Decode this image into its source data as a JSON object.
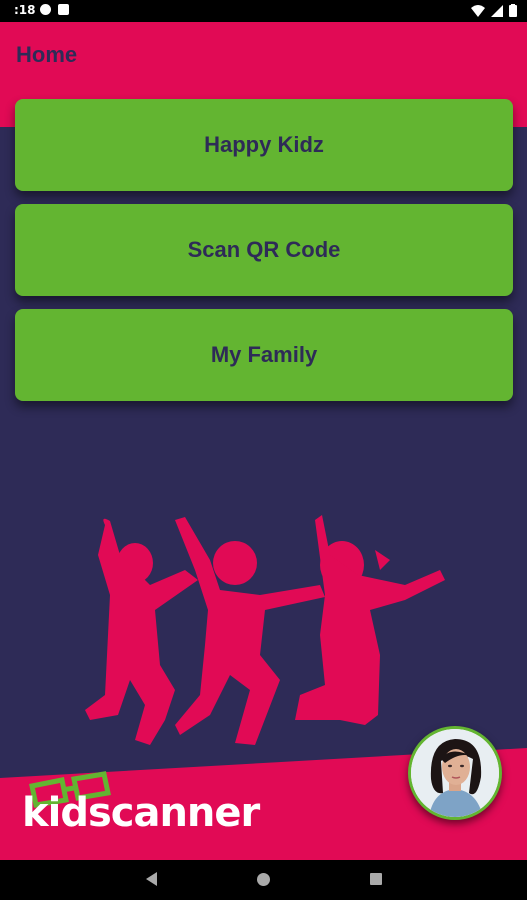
{
  "status_bar": {
    "time": ":18"
  },
  "header": {
    "title": "Home"
  },
  "menu": {
    "items": [
      {
        "label": "Happy Kidz"
      },
      {
        "label": "Scan QR Code"
      },
      {
        "label": "My Family"
      }
    ]
  },
  "brand": {
    "name": "kidscanner"
  },
  "colors": {
    "background": "#2e2b57",
    "accent": "#e10a55",
    "button": "#63b531",
    "button_text": "#2e2b57"
  },
  "icons": {
    "nav_back": "triangle-back-icon",
    "nav_home": "circle-home-icon",
    "nav_recents": "square-recents-icon",
    "logo_glasses": "glasses-icon",
    "avatar": "user-avatar"
  }
}
